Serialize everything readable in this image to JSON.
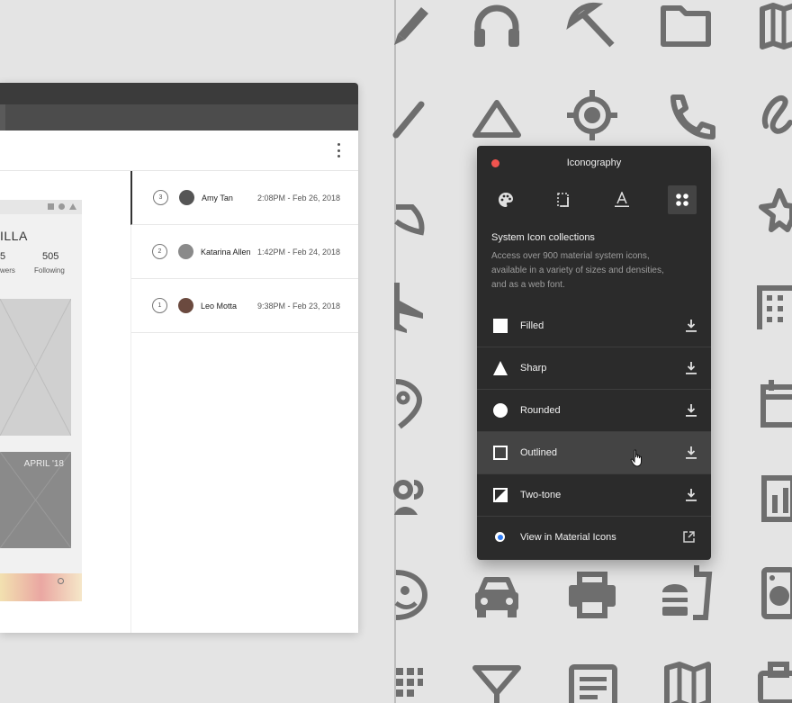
{
  "app_window": {
    "profile": {
      "name_partial": "ILLA",
      "followers_count_partial": "5",
      "followers_label_partial": "wers",
      "following_count": "505",
      "following_label": "Following",
      "banner_date": "APRIL '18"
    },
    "history": [
      {
        "version": "3",
        "user": "Amy Tan",
        "date": "2:08PM - Feb 26, 2018",
        "avatar_color": "#555555"
      },
      {
        "version": "2",
        "user": "Katarina Allen",
        "date": "1:42PM - Feb 24, 2018",
        "avatar_color": "#8a8a8a"
      },
      {
        "version": "1",
        "user": "Leo Motta",
        "date": "9:38PM - Feb 23, 2018",
        "avatar_color": "#6b4a3f"
      }
    ]
  },
  "panel": {
    "title": "Iconography",
    "tabs": [
      {
        "icon": "palette-icon"
      },
      {
        "icon": "crop-frame-icon"
      },
      {
        "icon": "text-format-icon"
      },
      {
        "icon": "apps-grid-icon",
        "selected": true
      }
    ],
    "collections_heading": "System Icon collections",
    "collections_description": "Access over 900 material system icons, available in a variety of sizes and densities, and as a web font.",
    "styles": [
      {
        "label": "Filled",
        "swatch": "filled-square-icon"
      },
      {
        "label": "Sharp",
        "swatch": "triangle-icon"
      },
      {
        "label": "Rounded",
        "swatch": "circle-icon"
      },
      {
        "label": "Outlined",
        "swatch": "outlined-square-icon",
        "hovered": true
      },
      {
        "label": "Two-tone",
        "swatch": "two-tone-square-icon"
      }
    ],
    "view_link": "View in Material Icons"
  },
  "colors": {
    "close_button": "#f0544f",
    "panel_background": "#2b2b2b",
    "radio_accent": "#2e7cf6",
    "background_icons": "#6e6e6e"
  },
  "background_icons": [
    "pencil-icon",
    "headphones-icon",
    "beach-umbrella-icon",
    "folder-icon",
    "map-icon",
    "line-icon",
    "triangle-icon",
    "gps-fixed-icon",
    "phone-icon",
    "gesture-icon",
    "star-icon",
    "airplane-icon",
    "location-pin-icon",
    "business-icon",
    "event-icon",
    "people-icon",
    "bar-chart-icon",
    "face-icon",
    "car-icon",
    "print-icon",
    "fastfood-icon",
    "washer-icon",
    "apps-icon",
    "cocktail-icon",
    "article-icon",
    "map-icon",
    "work-icon"
  ]
}
